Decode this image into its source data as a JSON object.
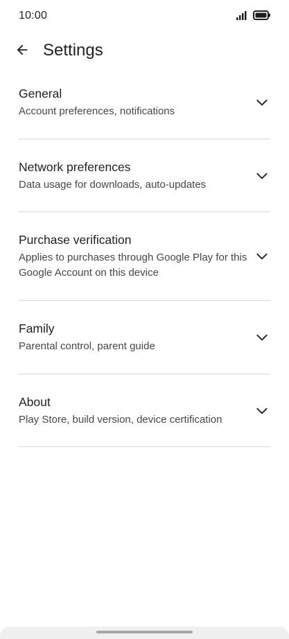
{
  "status_bar": {
    "time": "10:00",
    "icons": [
      "signal-icon",
      "battery-icon"
    ]
  },
  "app_bar": {
    "back_icon": "arrow-back-icon",
    "title": "Settings"
  },
  "settings": [
    {
      "title": "General",
      "subtitle": "Account preferences, notifications",
      "icon": "chevron-down-icon"
    },
    {
      "title": "Network preferences",
      "subtitle": "Data usage for downloads, auto-updates",
      "icon": "chevron-down-icon"
    },
    {
      "title": "Purchase verification",
      "subtitle": "Applies to purchases through Google Play for this Google Account on this device",
      "icon": "chevron-down-icon"
    },
    {
      "title": "Family",
      "subtitle": "Parental control, parent guide",
      "icon": "chevron-down-icon"
    },
    {
      "title": "About",
      "subtitle": "Play Store, build version, device certification",
      "icon": "chevron-down-icon"
    }
  ],
  "colors": {
    "text_primary": "#1f1f1f",
    "text_secondary": "#444746",
    "divider": "#d6d6d6",
    "background": "#ffffff"
  }
}
